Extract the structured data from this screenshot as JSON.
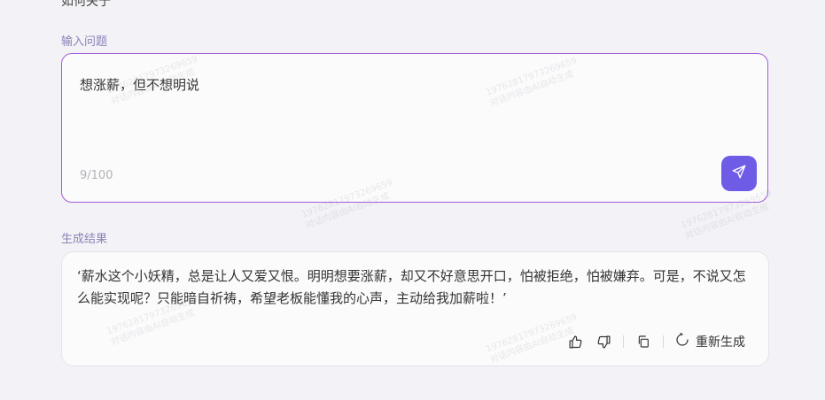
{
  "top_partial_label": "如何关于",
  "input_section": {
    "label": "输入问题",
    "value": "想涨薪，但不想明说",
    "char_count": "9/100"
  },
  "result_section": {
    "label": "生成结果",
    "text": "‘薪水这个小妖精，总是让人又爱又恨。明明想要涨薪，却又不好意思开口，怕被拒绝，怕被嫌弃。可是，不说又怎么能实现呢？只能暗自祈祷，希望老板能懂我的心声，主动给我加薪啦！’",
    "regenerate_label": "重新生成"
  },
  "watermark": {
    "line1": "19762817973269659",
    "line2": "对话内容由AI自动生成"
  },
  "colors": {
    "accent": "#6f5ce6",
    "input_border": "#a25cd8",
    "label": "#8c82b8",
    "background": "#f3f2f6"
  },
  "icons": {
    "send": "send-icon",
    "like": "thumb-up-icon",
    "dislike": "thumb-down-icon",
    "copy": "copy-icon",
    "regenerate": "refresh-icon"
  }
}
